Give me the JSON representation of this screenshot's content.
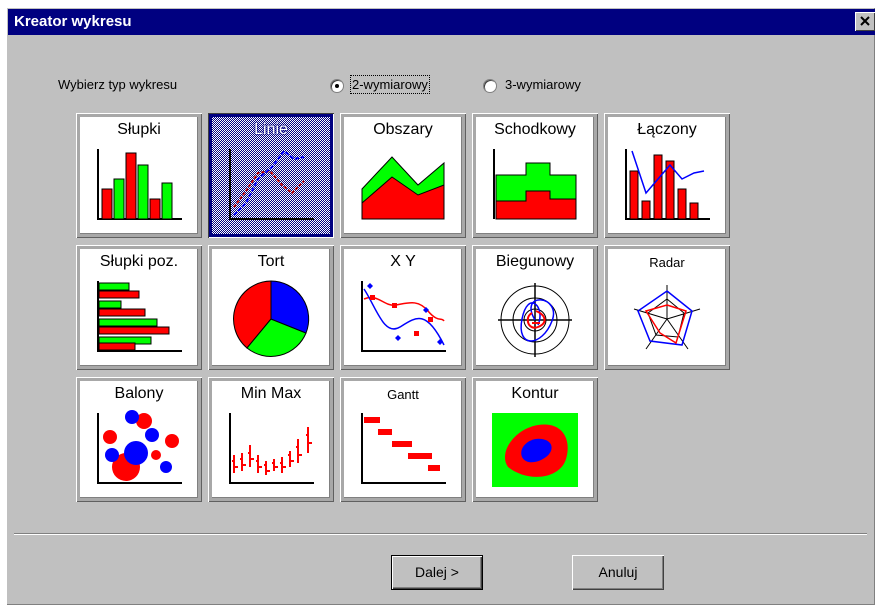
{
  "window": {
    "title": "Kreator wykresu",
    "close_glyph": "×"
  },
  "chart_type": {
    "label": "Wybierz typ wykresu",
    "options": [
      {
        "label": "2-wymiarowy",
        "selected": true
      },
      {
        "label": "3-wymiarowy",
        "selected": false
      }
    ]
  },
  "chart_types": [
    {
      "label": "Słupki",
      "icon": "bar-chart-icon"
    },
    {
      "label": "Linie",
      "icon": "line-chart-icon",
      "selected": true
    },
    {
      "label": "Obszary",
      "icon": "area-chart-icon"
    },
    {
      "label": "Schodkowy",
      "icon": "step-chart-icon"
    },
    {
      "label": "Łączony",
      "icon": "combo-chart-icon"
    },
    {
      "label": "Słupki poz.",
      "icon": "horizontal-bar-chart-icon"
    },
    {
      "label": "Tort",
      "icon": "pie-chart-icon"
    },
    {
      "label": "X Y",
      "icon": "xy-scatter-chart-icon"
    },
    {
      "label": "Biegunowy",
      "icon": "polar-chart-icon"
    },
    {
      "label": "Radar",
      "icon": "radar-chart-icon"
    },
    {
      "label": "Balony",
      "icon": "bubble-chart-icon"
    },
    {
      "label": "Min Max",
      "icon": "min-max-chart-icon"
    },
    {
      "label": "Gantt",
      "icon": "gantt-chart-icon"
    },
    {
      "label": "Kontur",
      "icon": "contour-chart-icon"
    }
  ],
  "buttons": {
    "next": "Dalej >",
    "cancel": "Anuluj"
  },
  "colors": {
    "titlebar": "#000080",
    "dialog": "#c0c0c0",
    "red": "#ff0000",
    "green": "#00ff00",
    "blue": "#0000ff"
  }
}
